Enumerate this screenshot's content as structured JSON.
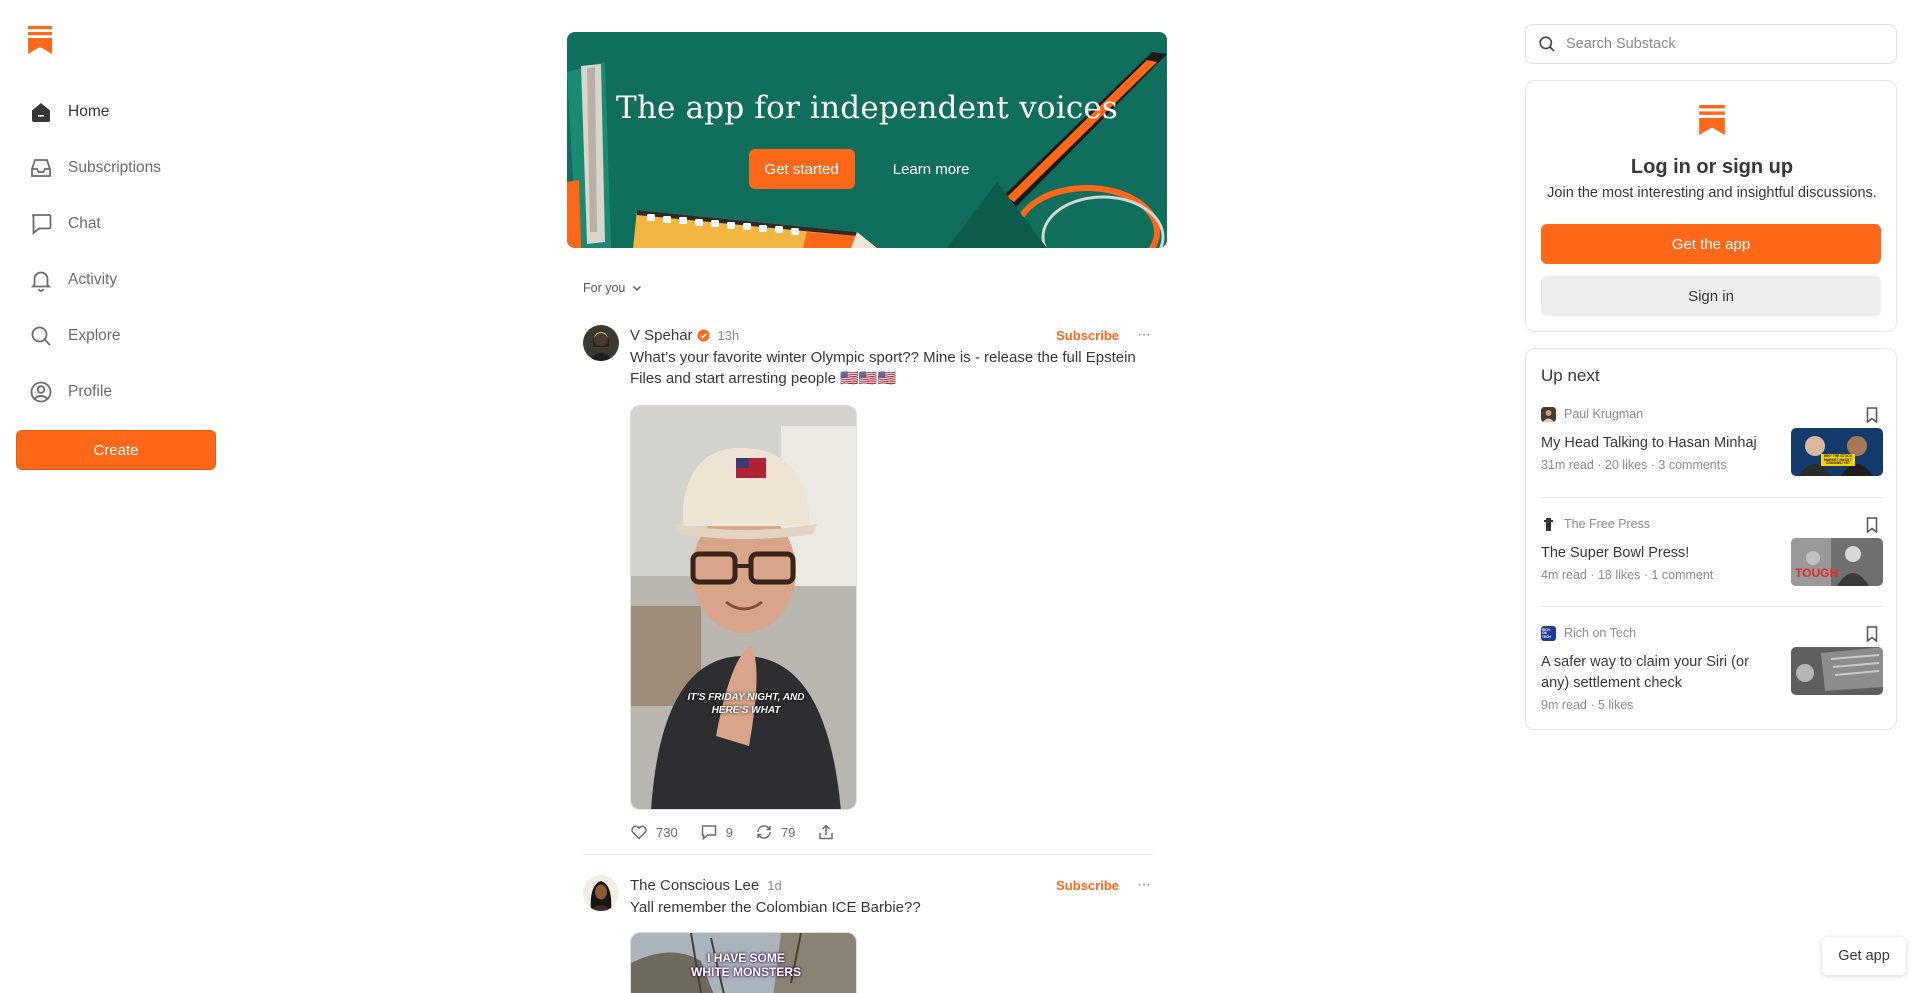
{
  "colors": {
    "accent": "#ff6719",
    "hero_bg": "#0f6e5c",
    "text": "#363737",
    "muted": "#8a8a8a"
  },
  "nav": {
    "items": [
      {
        "label": "Home",
        "icon": "home-icon",
        "active": true
      },
      {
        "label": "Subscriptions",
        "icon": "inbox-icon",
        "active": false
      },
      {
        "label": "Chat",
        "icon": "chat-bubble-icon",
        "active": false
      },
      {
        "label": "Activity",
        "icon": "bell-icon",
        "active": false
      },
      {
        "label": "Explore",
        "icon": "search-icon",
        "active": false
      },
      {
        "label": "Profile",
        "icon": "profile-icon",
        "active": false
      }
    ],
    "create_label": "Create"
  },
  "hero": {
    "title": "The app for independent voices",
    "primary_label": "Get started",
    "secondary_label": "Learn more"
  },
  "feed": {
    "filter_label": "For you",
    "posts": [
      {
        "author": "V Spehar",
        "verified": true,
        "time": "13h",
        "subscribe_label": "Subscribe",
        "text": "What’s your favorite winter Olympic sport?? Mine is - release the full Epstein Files and start arresting people 🇺🇸🇺🇸🇺🇸",
        "video_caption": "IT'S FRIDAY NIGHT, AND HERE'S WHAT",
        "likes": "730",
        "comments": "9",
        "restacks": "79"
      },
      {
        "author": "The Conscious Lee",
        "verified": false,
        "time": "1d",
        "subscribe_label": "Subscribe",
        "text": "Yall remember the Colombian ICE Barbie??",
        "video_caption": "I HAVE SOME WHITE MONSTERS"
      }
    ]
  },
  "search": {
    "placeholder": "Search Substack"
  },
  "login": {
    "title": "Log in or sign up",
    "subtitle": "Join the most interesting and insightful discussions.",
    "get_app_label": "Get the app",
    "sign_in_label": "Sign in"
  },
  "up_next": {
    "heading": "Up next",
    "items": [
      {
        "publication": "Paul Krugman",
        "title": "My Head Talking to Hasan Minhaj",
        "meta": "31m read · 20 likes · 3 comments",
        "thumb_caption": "WHY THE STOCK MARKET HASN'T CRASHED YET"
      },
      {
        "publication": "The Free Press",
        "title": "The Super Bowl Press!",
        "meta": "4m read · 18 likes · 1 comment",
        "thumb_caption": "TOUGH"
      },
      {
        "publication": "Rich on Tech",
        "title": "A safer way to claim your Siri (or any) settlement check",
        "meta": "9m read · 5 likes",
        "pub_badge": "RICH ON TECH"
      }
    ]
  },
  "floating": {
    "get_app_label": "Get app"
  }
}
